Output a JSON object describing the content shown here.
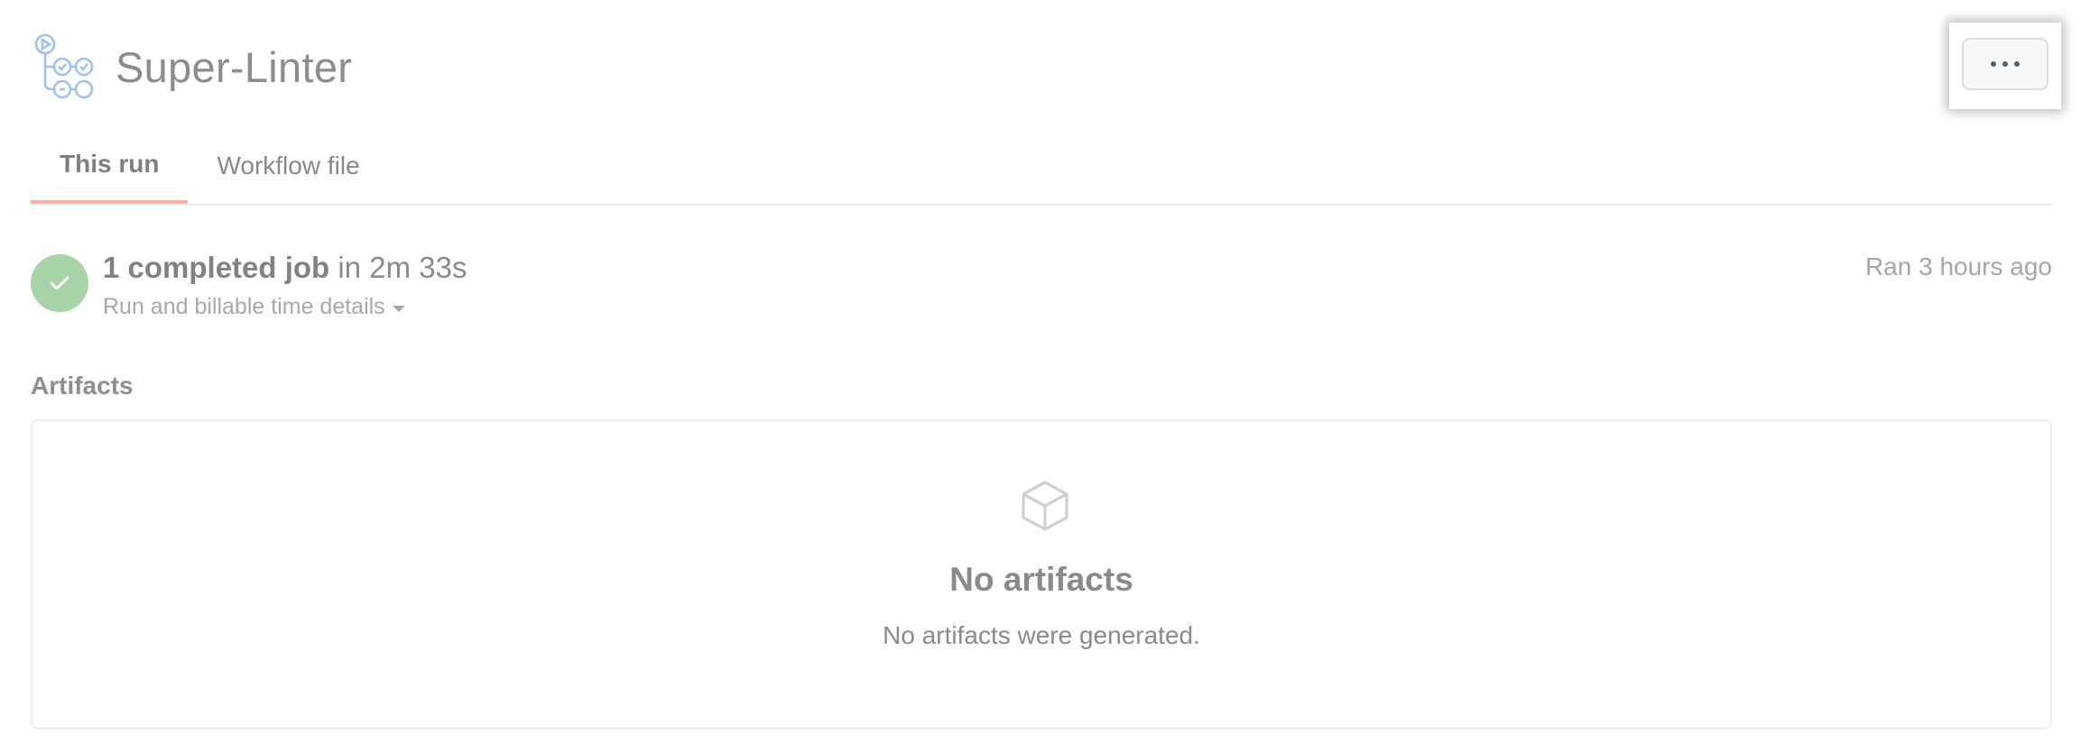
{
  "header": {
    "title": "Super-Linter",
    "logo_icon": "workflow-icon",
    "more_button_icon": "kebab-horizontal-icon"
  },
  "tabs": [
    {
      "label": "This run",
      "active": true
    },
    {
      "label": "Workflow file",
      "active": false
    }
  ],
  "summary": {
    "status_icon": "check-icon",
    "status_color": "#a7d3a6",
    "jobs_label": "1 completed job",
    "duration": "in 2m 33s",
    "details_link": "Run and billable time details",
    "ran_ago": "Ran 3 hours ago"
  },
  "artifacts": {
    "heading": "Artifacts",
    "empty_icon": "package-icon",
    "empty_title": "No artifacts",
    "empty_text": "No artifacts were generated."
  },
  "colors": {
    "active_tab_underline": "#f4b4a6",
    "logo_accent": "#9fc1ee"
  }
}
